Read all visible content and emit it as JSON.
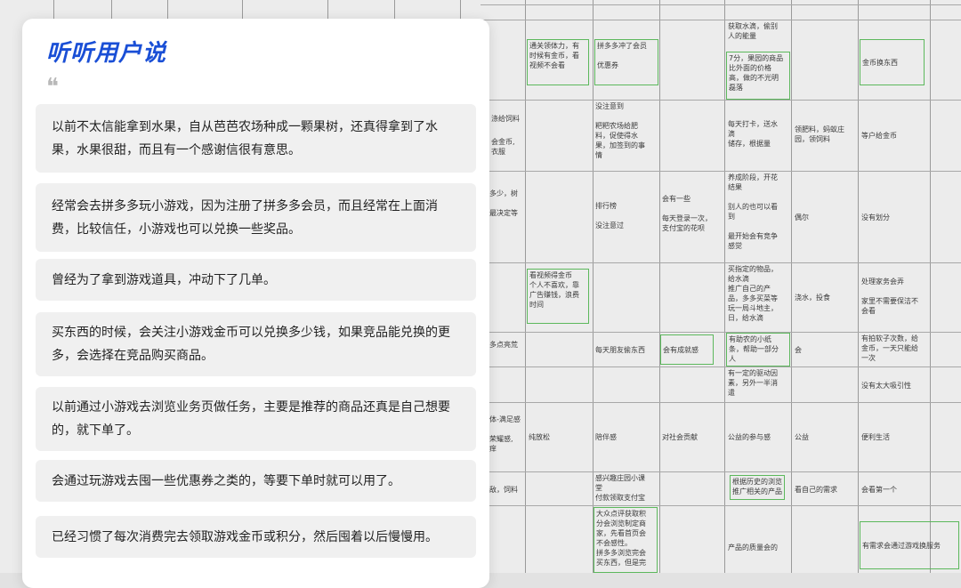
{
  "card": {
    "title": "听听用户说",
    "quote_mark": "❝",
    "quotes": [
      "以前不太信能拿到水果，自从芭芭农场种成一颗果树，还真得拿到了水果，水果很甜，而且有一个感谢信很有意思。",
      "经常会去拼多多玩小游戏，因为注册了拼多多会员，而且经常在上面消费，比较信任，小游戏也可以兑换一些奖品。",
      "曾经为了拿到游戏道具，冲动下了几单。",
      "买东西的时候，会关注小游戏金币可以兑换多少钱，如果竞品能兑换的更多，会选择在竞品购买商品。",
      "以前通过小游戏去浏览业务页做任务，主要是推荐的商品还真是自己想要的，就下单了。",
      "会通过玩游戏去囤一些优惠券之类的，等要下单时就可以用了。",
      "已经习惯了每次消费完去领取游戏金币或积分，然后囤着以后慢慢用。"
    ]
  },
  "sheet": {
    "cells": [
      {
        "text": "获取水滴，偷别\n人的能量",
        "boxed": false
      },
      {
        "text": "通关领体力，有\n时候有金币，看\n视频不会看",
        "boxed": true
      },
      {
        "text": "拼多多冲了会员\n\n优惠券",
        "boxed": true
      },
      {
        "text": "7分，果园的商品\n比外面的价格\n高，做的不光明\n磊落",
        "boxed": true
      },
      {
        "text": "金币换东西",
        "boxed": true
      },
      {
        "text": "涤给饲料",
        "boxed": false
      },
      {
        "text": "会金币,\n衣服",
        "boxed": false
      },
      {
        "text": "没注意到\n\n粑粑农场给肥\n料，促使得水\n果，加签到的事\n情",
        "boxed": false
      },
      {
        "text": "每天打卡，送水\n滴\n储存，根据量",
        "boxed": false
      },
      {
        "text": "领肥料，蚂蚁庄\n园，领饲料",
        "boxed": false
      },
      {
        "text": "等户给金币",
        "boxed": false
      },
      {
        "text": "多少，树\n\n最决定等",
        "boxed": false
      },
      {
        "text": "排行榜\n\n没注意过",
        "boxed": false
      },
      {
        "text": "会有一些\n\n每天登录一次，\n支付宝的花呗",
        "boxed": false
      },
      {
        "text": "养成阶段，开花\n结果\n\n别人的也可以看\n到\n\n最开始会有竞争\n感觉",
        "boxed": false
      },
      {
        "text": "偶尔",
        "boxed": false
      },
      {
        "text": "没有划分",
        "boxed": false
      },
      {
        "text": "看视频得金币\n个人不喜欢，靠\n广告赚钱，浪费\n时间",
        "boxed": true
      },
      {
        "text": "买指定的物品，\n给水滴\n推广自己的产\n品，多多买菜等\n玩一局斗地主，\n日，给水滴",
        "boxed": false
      },
      {
        "text": "浇水，投食",
        "boxed": false
      },
      {
        "text": "处理家务会弄\n\n家里不需要保洁不\n会看",
        "boxed": false
      },
      {
        "text": "多点亮荒",
        "boxed": false
      },
      {
        "text": "每天朋友偷东西",
        "boxed": false
      },
      {
        "text": "会有成就感",
        "boxed": true
      },
      {
        "text": "有助农的小纸\n条，帮助一部分\n人",
        "boxed": true
      },
      {
        "text": "会",
        "boxed": false
      },
      {
        "text": "有拍软子次数，给\n金币，一天只能给\n一次",
        "boxed": false
      },
      {
        "text": "有一定的驱动因\n素，另外一半消\n遣",
        "boxed": false
      },
      {
        "text": "没有太大吸引性",
        "boxed": false
      },
      {
        "text": "体-满足感\n\n荣耀感,\n痒",
        "boxed": false
      },
      {
        "text": "纯放松",
        "boxed": false
      },
      {
        "text": "陪伴感",
        "boxed": false
      },
      {
        "text": "对社会贡献",
        "boxed": false
      },
      {
        "text": "公益的参与感",
        "boxed": false
      },
      {
        "text": "公益",
        "boxed": false
      },
      {
        "text": "便利生活",
        "boxed": false
      },
      {
        "text": "感兴趣庄园小课\n堂\n付款领取支付宝",
        "boxed": false
      },
      {
        "text": "根据历史的浏览\n推广相关的产品",
        "boxed": true
      },
      {
        "text": "看自己的需求",
        "boxed": false
      },
      {
        "text": "会看第一个",
        "boxed": false
      },
      {
        "text": "敌，饲料",
        "boxed": false
      },
      {
        "text": "大众点评获取积\n分会浏览制定商\n家，先看首页会\n不会感性。\n拼多多浏览完会\n买东西，但是完",
        "boxed": true
      },
      {
        "text": "产品的质量会的",
        "boxed": false
      },
      {
        "text": "有需求会通过游戏换服务",
        "boxed": true
      }
    ]
  }
}
